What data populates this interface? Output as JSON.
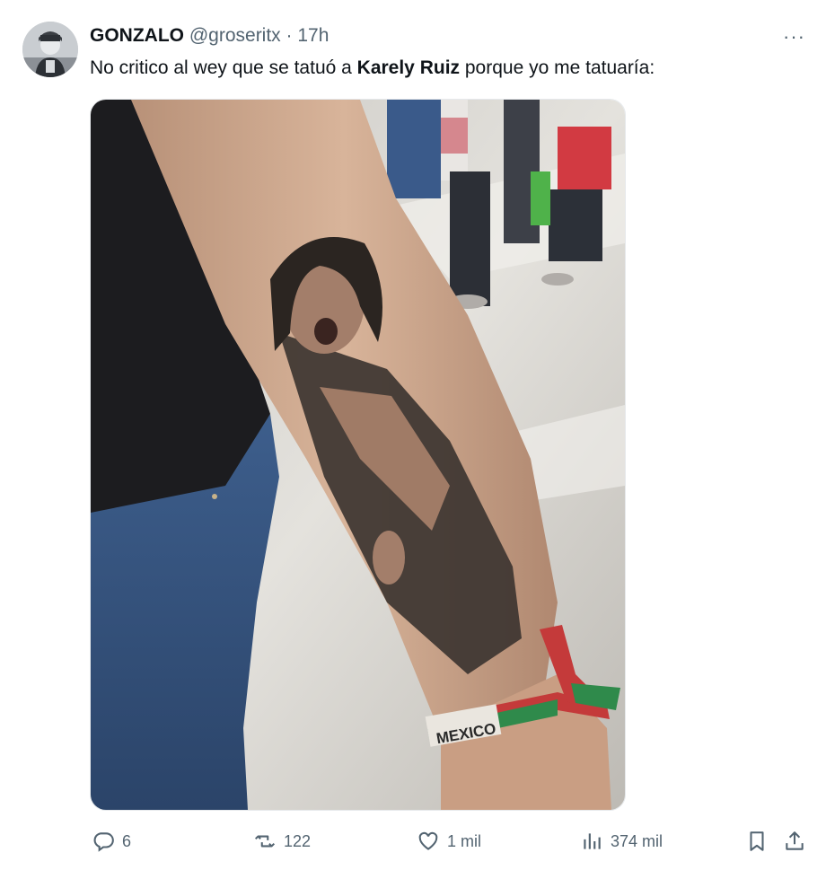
{
  "tweet": {
    "author_name": "GONZALO",
    "handle": "@groseritx",
    "separator": "·",
    "time": "17h",
    "more_icon": "···",
    "text_before": "No critico al wey que se tatuó a ",
    "text_bold": "Karely Ruiz",
    "text_after": " porque yo me tatuaría:",
    "wristband_text": "MEXICO"
  },
  "actions": {
    "replies": "6",
    "retweets": "122",
    "likes": "1 mil",
    "views": "374 mil"
  },
  "icons": {
    "reply": "reply-icon",
    "retweet": "retweet-icon",
    "like": "like-icon",
    "views": "views-icon",
    "bookmark": "bookmark-icon",
    "share": "share-icon",
    "more": "more-icon"
  },
  "colors": {
    "text": "#0f1419",
    "secondary": "#536471"
  }
}
